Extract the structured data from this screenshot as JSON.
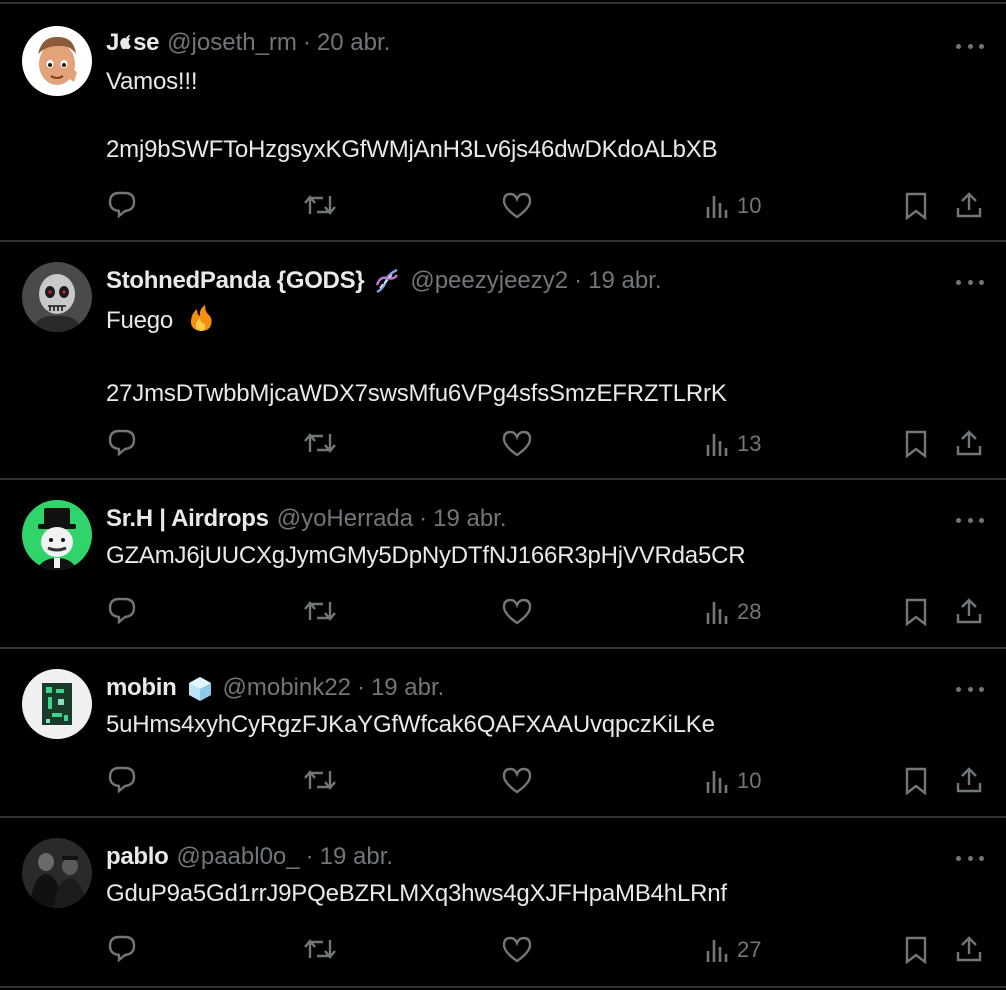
{
  "tweets": [
    {
      "name": "J\u0000se",
      "name_display": "Jse",
      "handle": "@joseth_rm",
      "date": "20 abr.",
      "lines": [
        "Vamos!!!",
        "",
        "2mj9bSWFToHzgsyxKGfWMjAnH3Lv6js46dwDKdoALbXB"
      ],
      "views": "10",
      "avatar": "memoji-avatar"
    },
    {
      "name": "StohnedPanda {GODS}",
      "handle": "@peezyjeezy2",
      "date": "19 abr.",
      "lines": [
        "Fuego",
        "",
        "27JmsDTwbbMjcaWDX7swsMfu6VPg4sfsSmzEFRZTLRrK"
      ],
      "views": "13",
      "avatar": "skull-avatar",
      "badge": "dna-emoji"
    },
    {
      "name": "Sr.H | Airdrops",
      "handle": "@yoHerrada",
      "date": "19 abr.",
      "lines": [
        "GZAmJ6jUUCXgJymGMy5DpNyDTfNJ166R3pHjVVRda5CR"
      ],
      "views": "28",
      "avatar": "monopoly-man-avatar"
    },
    {
      "name": "mobin",
      "handle": "@mobink22",
      "date": "19 abr.",
      "lines": [
        "5uHms4xyhCyRgzFJKaYGfWfcak6QAFXAAUvqpczKiLKe"
      ],
      "views": "10",
      "avatar": "pixel-art-avatar",
      "badge": "ice-cube-emoji"
    },
    {
      "name": "pablo",
      "handle": "@paabl0o_",
      "date": "19 abr.",
      "lines": [
        "GduP9a5Gd1rrJ9PQeBZRLMXq3hws4gXJFHpaMB4hLRnf"
      ],
      "views": "27",
      "avatar": "photo-avatar"
    }
  ],
  "j_prefix": "J",
  "se_suffix": "se",
  "fire_emoji": "fire-emoji",
  "colors": {
    "background": "#000000",
    "text": "#e7e9ea",
    "muted": "#71767b",
    "divider": "#2f3336"
  }
}
